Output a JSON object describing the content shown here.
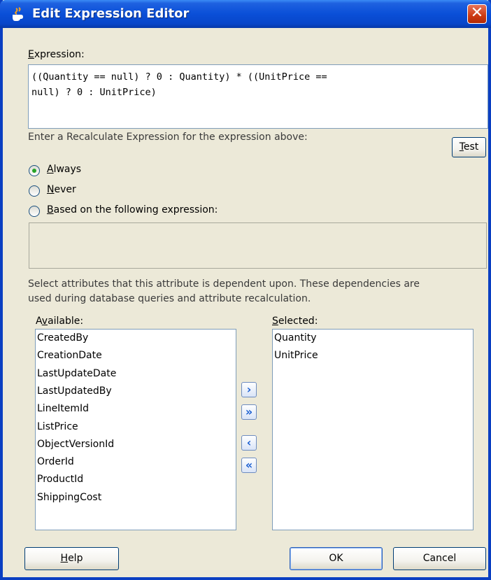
{
  "window": {
    "title": "Edit Expression Editor",
    "close_glyph": "✕"
  },
  "expression": {
    "label": "Expression:",
    "value": "((Quantity == null) ? 0 : Quantity) * ((UnitPrice ==\nnull) ? 0 : UnitPrice)"
  },
  "recalc": {
    "prompt": "Enter a Recalculate Expression for the expression above:",
    "test_label": "Test",
    "options": [
      {
        "label": "Always",
        "checked": true
      },
      {
        "label": "Never",
        "checked": false
      },
      {
        "label": "Based on the following expression:",
        "checked": false
      }
    ],
    "based_expression": ""
  },
  "dependencies": {
    "description_line1": "Select attributes that this attribute is dependent upon. These dependencies are",
    "description_line2": "used during database queries and attribute recalculation.",
    "available_label": "Available:",
    "selected_label": "Selected:",
    "available": [
      "CreatedBy",
      "CreationDate",
      "LastUpdateDate",
      "LastUpdatedBy",
      "LineItemId",
      "ListPrice",
      "ObjectVersionId",
      "OrderId",
      "ProductId",
      "ShippingCost"
    ],
    "selected": [
      "Quantity",
      "UnitPrice"
    ],
    "shuttle": {
      "move_one_icon": "chevron-right-icon",
      "move_all_icon": "double-chevron-right-icon",
      "remove_one_icon": "chevron-left-icon",
      "remove_all_icon": "double-chevron-left-icon"
    }
  },
  "footer": {
    "help_label": "Help",
    "ok_label": "OK",
    "cancel_label": "Cancel"
  },
  "colors": {
    "titlebar": "#0a4fd8",
    "dialog_bg": "#ece9d8",
    "close": "#cc3a12",
    "radio_dot": "#28a428"
  }
}
